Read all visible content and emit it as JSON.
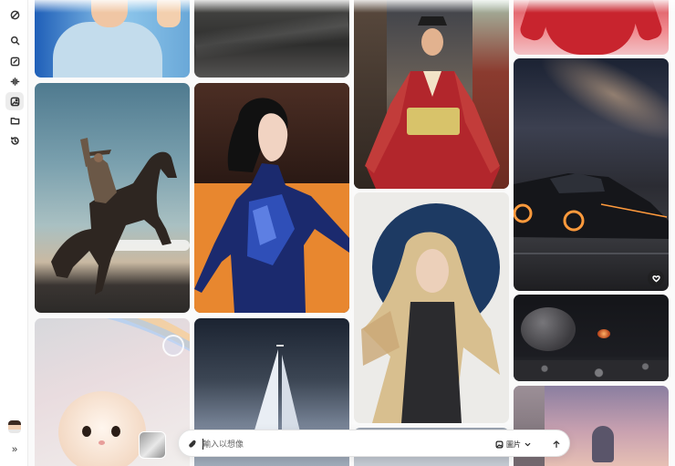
{
  "sidebar": {
    "items": [
      {
        "name": "logo",
        "icon": "logo-icon"
      },
      {
        "name": "search",
        "icon": "search-icon"
      },
      {
        "name": "edit",
        "icon": "edit-icon"
      },
      {
        "name": "audio",
        "icon": "waveform-icon"
      },
      {
        "name": "image",
        "icon": "image-icon"
      },
      {
        "name": "folder",
        "icon": "folder-icon"
      },
      {
        "name": "history",
        "icon": "history-icon"
      }
    ],
    "expand_icon": "double-chevron-right-icon",
    "expand_label": "»"
  },
  "gallery": {
    "tiles": [
      "man-light-blue-shirt",
      "ocean-waves",
      "woman-kimono-street",
      "red-lanterns-hands",
      "cowboy-rearing-horse",
      "woman-black-hair-armor",
      "woman-blonde-blue-circle",
      "galaxy-futuristic-car",
      "kitten-rainbow-bubbles",
      "dark-sailboat-storm",
      "asteroid-space",
      "pink-sky-building"
    ],
    "favorite_icon": "heart-icon"
  },
  "prompt_bar": {
    "placeholder": "輸入以想像",
    "value": "",
    "mode_label": "圖片",
    "attach_icon": "paperclip-icon",
    "mode_icon": "image-icon",
    "dropdown_icon": "chevron-down-icon",
    "send_icon": "arrow-up-icon"
  },
  "colors": {
    "background": "#fafafa",
    "sidebar": "#ffffff",
    "prompt_bar": "#ffffff"
  }
}
